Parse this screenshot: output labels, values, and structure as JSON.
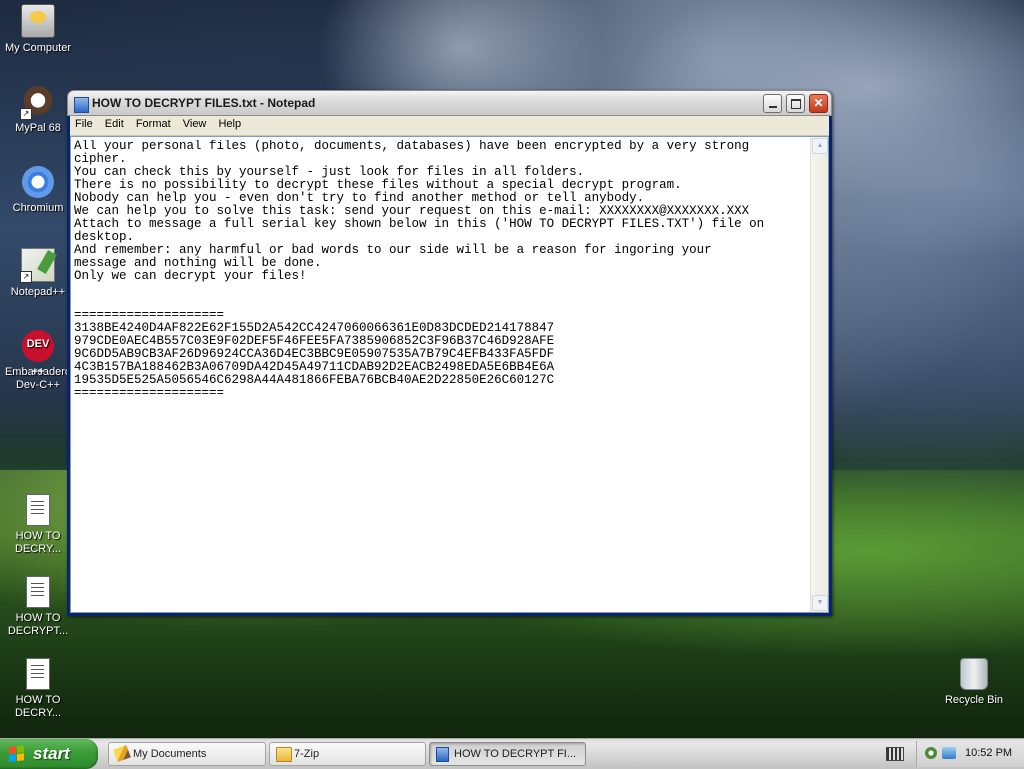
{
  "desktop": {
    "icons": [
      {
        "label": "My Computer"
      },
      {
        "label": "MyPal 68"
      },
      {
        "label": "Chromium"
      },
      {
        "label": "Notepad++"
      },
      {
        "label": "Embarcadero Dev-C++",
        "glyph": "DEV ++"
      },
      {
        "label": "HOW TO DECRY..."
      },
      {
        "label": "HOW TO DECRYPT..."
      },
      {
        "label": "HOW TO DECRY..."
      },
      {
        "label": "Recycle Bin"
      }
    ]
  },
  "window": {
    "title": "HOW TO DECRYPT FILES.txt - Notepad",
    "menu": [
      "File",
      "Edit",
      "Format",
      "View",
      "Help"
    ],
    "buttons": {
      "close": "✕"
    },
    "content": "All your personal files (photo, documents, databases) have been encrypted by a very strong\ncipher.\nYou can check this by yourself - just look for files in all folders.\nThere is no possibility to decrypt these files without a special decrypt program.\nNobody can help you - even don't try to find another method or tell anybody.\nWe can help you to solve this task: send your request on this e-mail: XXXXXXXX@XXXXXXX.XXX\nAttach to message a full serial key shown below in this ('HOW TO DECRYPT FILES.TXT') file on\ndesktop.\nAnd remember: any harmful or bad words to our side will be a reason for ingoring your\nmessage and nothing will be done.\nOnly we can decrypt your files!\n\n\n====================\n3138BE4240D4AF822E62F155D2A542CC4247060066361E0D83DCDED214178847\n979CDE0AEC4B557C03E9F02DEF5F46FEE5FA7385906852C3F96B37C46D928AFE\n9C6DD5AB9CB3AF26D96924CCA36D4EC3BBC9E05907535A7B79C4EFB433FA5FDF\n4C3B157BA188462B3A06709DA42D45A49711CDAB92D2EACB2498EDA5E6BB4E6A\n19535D5E525A5056546C6298A44A481866FEBA76BCB40AE2D22850E26C60127C\n===================="
  },
  "taskbar": {
    "start_label": "start",
    "tasks": [
      {
        "label": "My Documents"
      },
      {
        "label": "7-Zip"
      },
      {
        "label": "HOW TO DECRYPT FI..."
      }
    ],
    "clock": "10:52 PM"
  }
}
